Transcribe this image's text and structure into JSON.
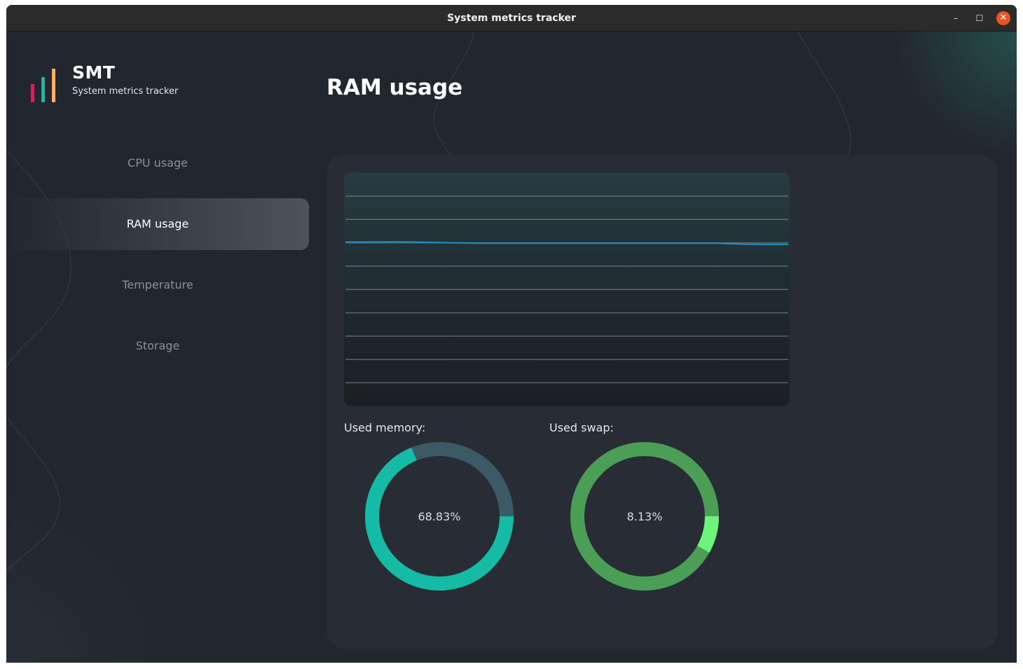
{
  "window": {
    "title": "System metrics tracker",
    "controls": {
      "minimize": "–",
      "maximize": "☐",
      "close": "✕"
    }
  },
  "sidebar": {
    "brand": {
      "name": "SMT",
      "subtitle": "System metrics tracker",
      "bar_colors": [
        "#c8285a",
        "#16bba6",
        "#f5b36a"
      ]
    },
    "items": [
      {
        "label": "CPU usage",
        "active": false
      },
      {
        "label": "RAM usage",
        "active": true
      },
      {
        "label": "Temperature",
        "active": false
      },
      {
        "label": "Storage",
        "active": false
      }
    ]
  },
  "main": {
    "page_title": "RAM usage",
    "graph": {
      "grid_lines": 9,
      "line_color": "#1f8fc8",
      "series_level_fraction": [
        0.702,
        0.702,
        0.703,
        0.702,
        0.7,
        0.698,
        0.697,
        0.697,
        0.697,
        0.697,
        0.697,
        0.697,
        0.697,
        0.697,
        0.697,
        0.697,
        0.697,
        0.693,
        0.692,
        0.692
      ]
    },
    "used_memory": {
      "label": "Used memory:",
      "value_text": "68.83%",
      "percent": 68.83,
      "fill_color": "#16bba6",
      "track_color": "#3b5a66"
    },
    "used_swap": {
      "label": "Used swap:",
      "value_text": "8.13%",
      "percent": 8.13,
      "fill_color": "#6cf57a",
      "track_color": "#4a9e55"
    }
  }
}
